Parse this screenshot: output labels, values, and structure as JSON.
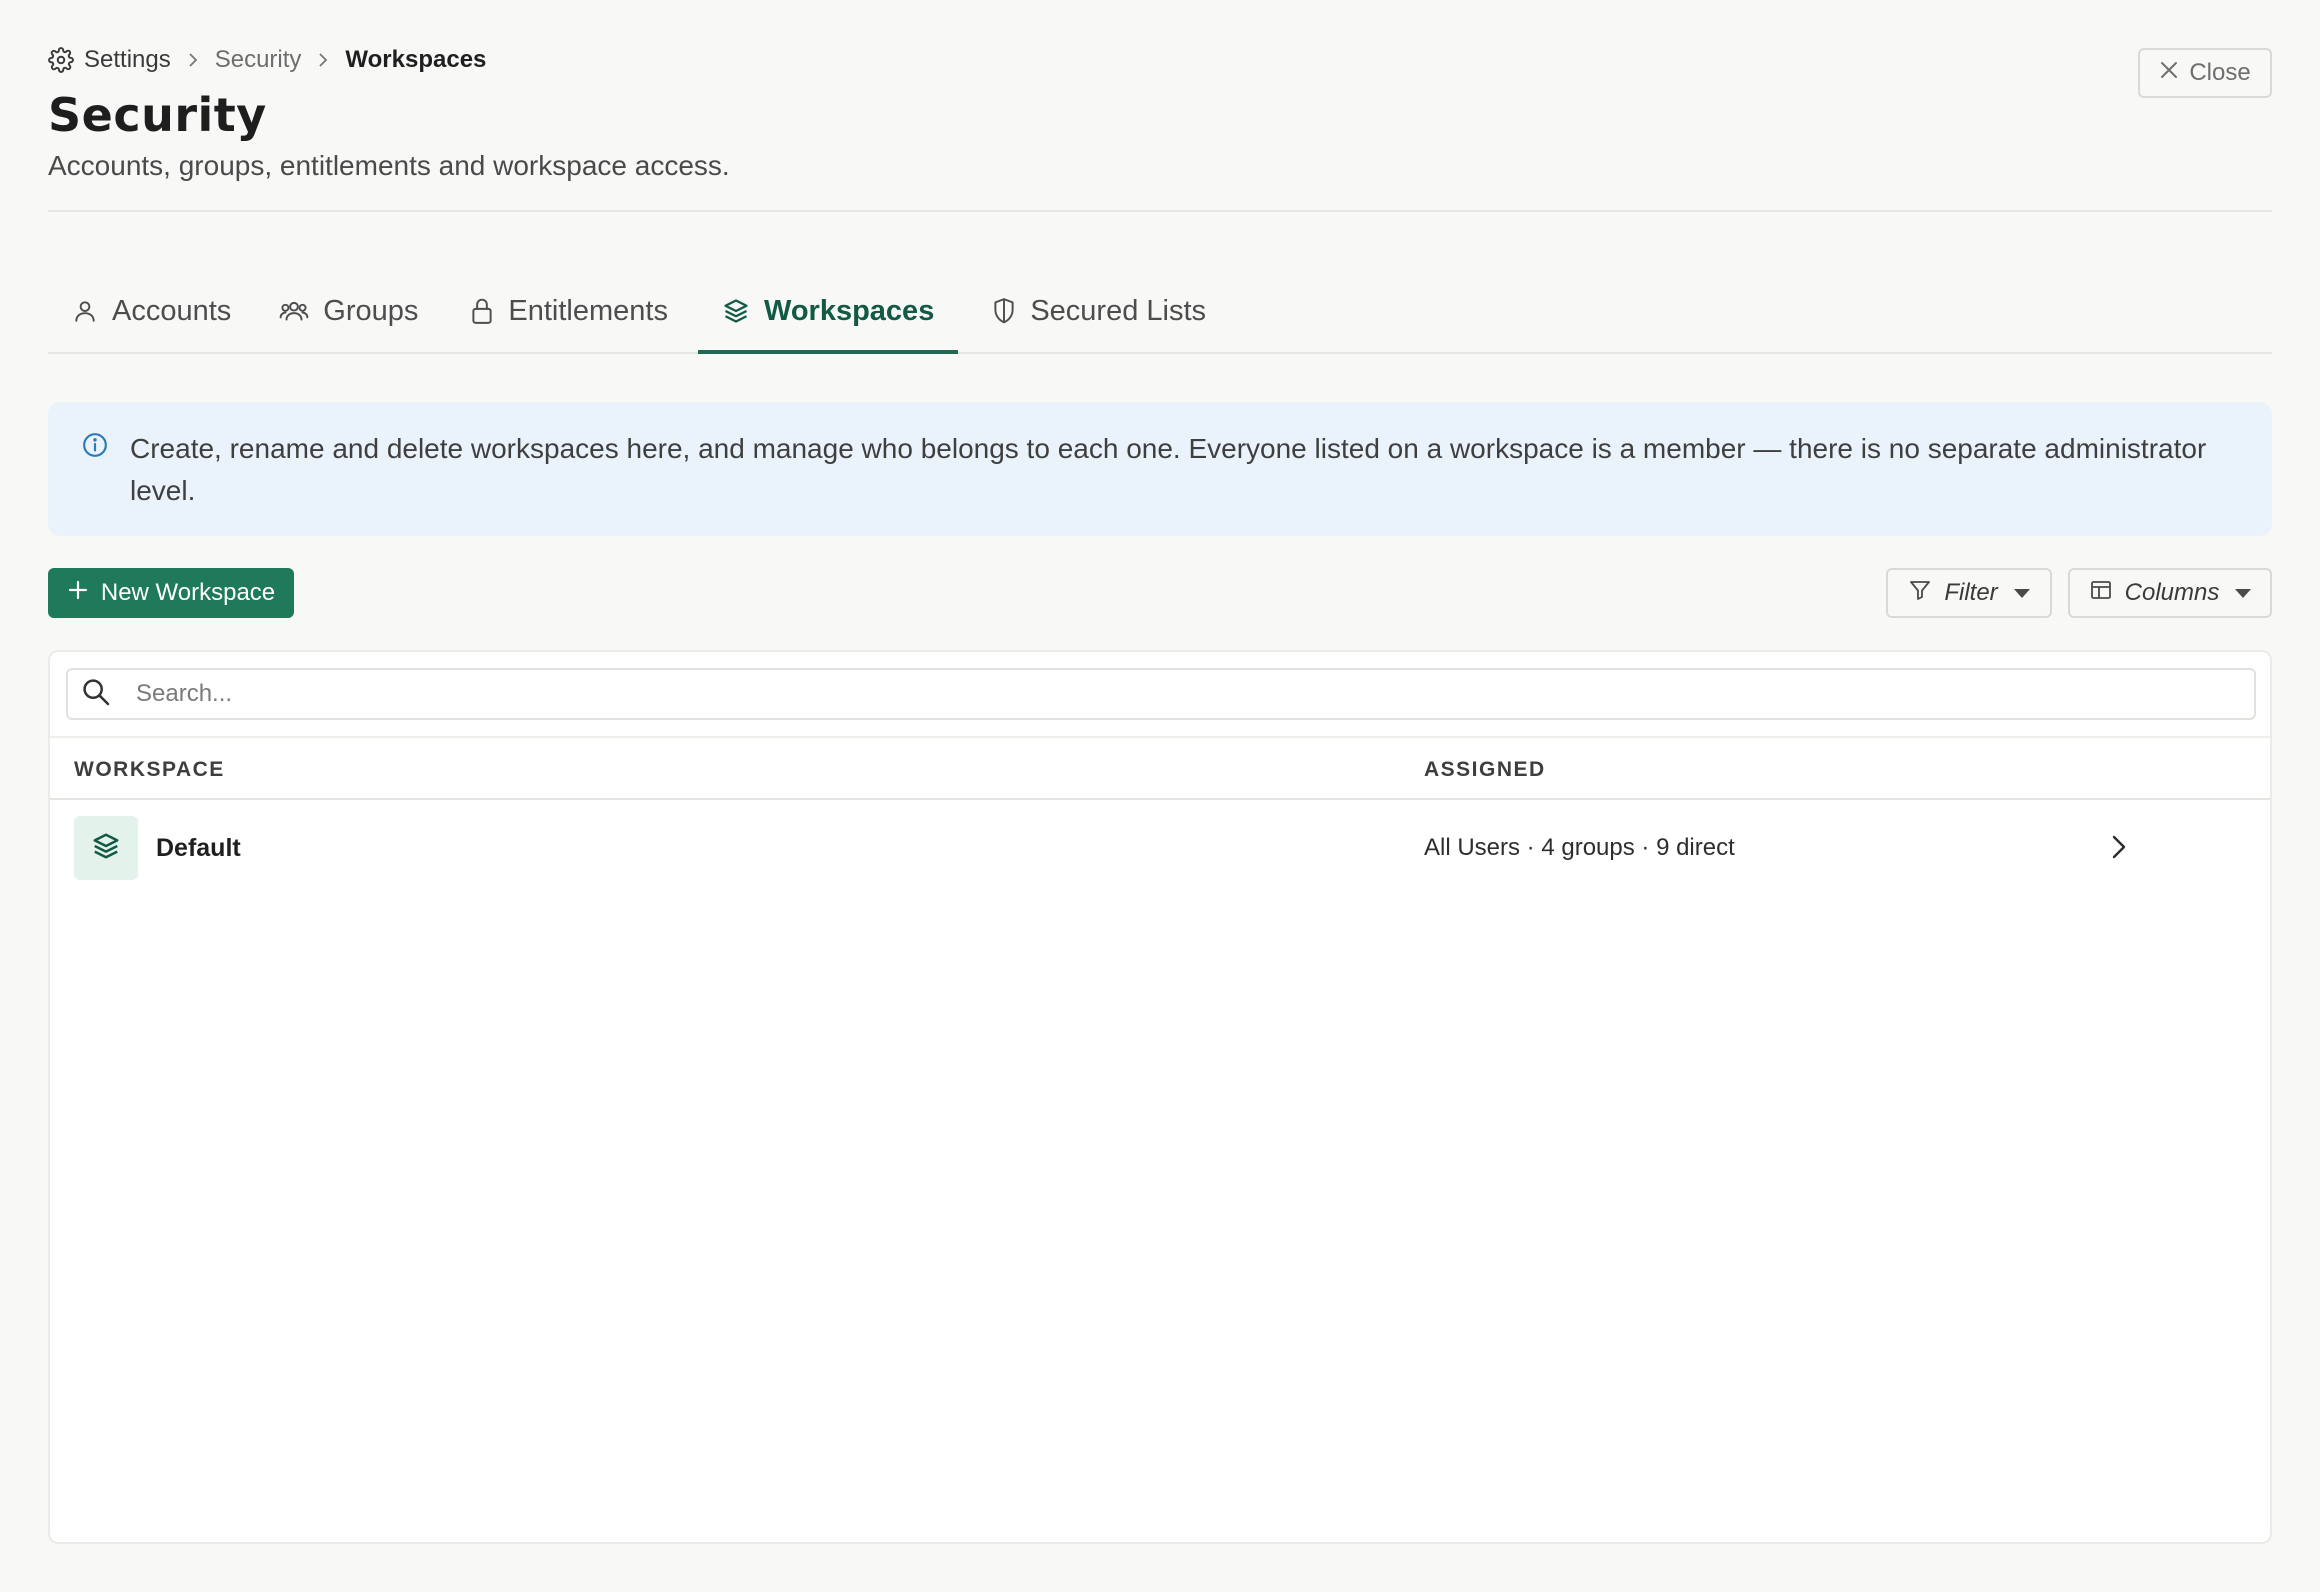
{
  "breadcrumb": {
    "settings": "Settings",
    "security": "Security",
    "current": "Workspaces"
  },
  "page": {
    "title": "Security",
    "subtitle": "Accounts, groups, entitlements and workspace access."
  },
  "close_label": "Close",
  "tabs": [
    {
      "label": "Accounts",
      "icon": "user-icon",
      "active": false
    },
    {
      "label": "Groups",
      "icon": "users-icon",
      "active": false
    },
    {
      "label": "Entitlements",
      "icon": "lock-icon",
      "active": false
    },
    {
      "label": "Workspaces",
      "icon": "layers-icon",
      "active": true
    },
    {
      "label": "Secured Lists",
      "icon": "shield-icon",
      "active": false
    }
  ],
  "info_banner": {
    "icon": "info-icon",
    "text": "Create, rename and delete workspaces here, and manage who belongs to each one. Everyone listed on a workspace is a member — there is no separate administrator level."
  },
  "toolbar": {
    "new_label": "New Workspace",
    "filter_label": "Filter",
    "columns_label": "Columns"
  },
  "search": {
    "placeholder": "Search..."
  },
  "table": {
    "columns": [
      "WORKSPACE",
      "ASSIGNED"
    ],
    "rows": [
      {
        "name": "Default",
        "assigned": "All Users · 4 groups · 9 direct",
        "icon": "layers-icon"
      }
    ]
  },
  "colors": {
    "accent": "#1f7a5c",
    "accent_dark": "#125a45",
    "info_bg": "#eaf3fb",
    "info_icon": "#2a7ab8",
    "page_bg": "#f8f8f7"
  }
}
